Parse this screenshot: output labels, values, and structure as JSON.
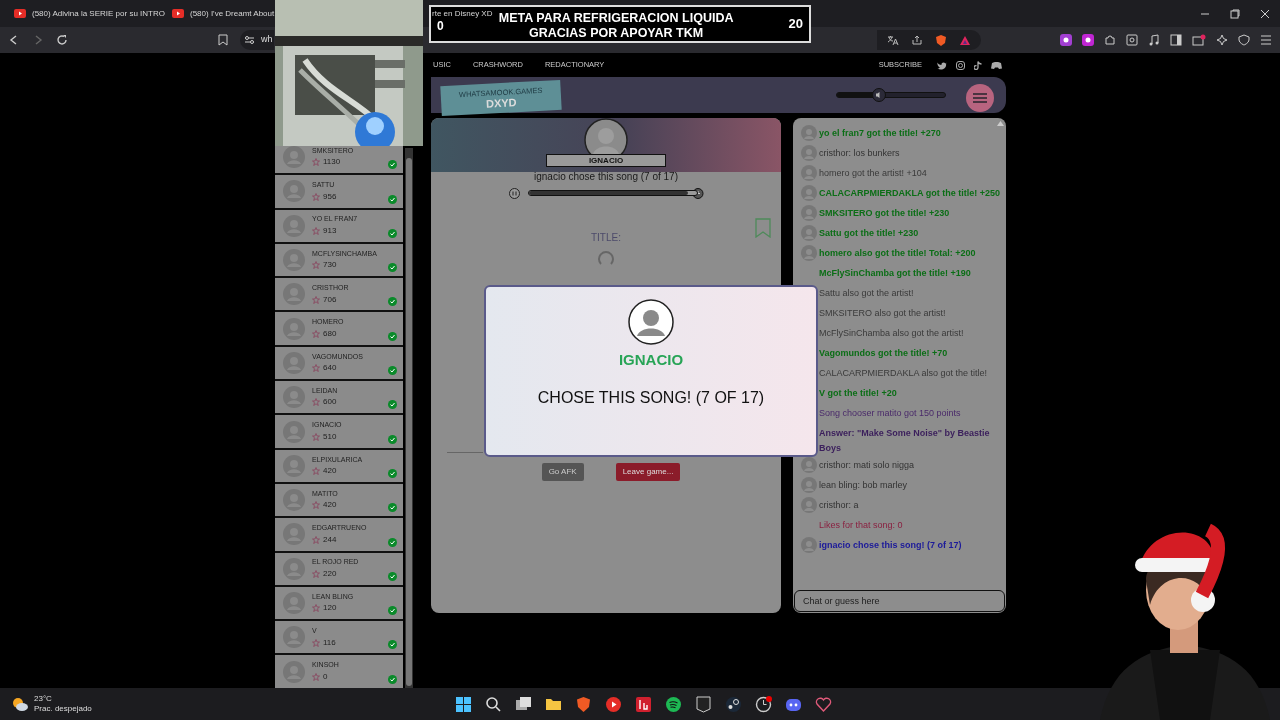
{
  "browser": {
    "tabs": [
      {
        "label": "(580) Adivina la SERIE por su INTRO",
        "selected": false
      },
      {
        "label": "(580) I've Dreamt About",
        "selected": false
      },
      {
        "label": "rte en Disney XD",
        "selected": false
      }
    ],
    "address": "wh"
  },
  "donation_goal": {
    "current": "0",
    "text": "META PARA REFRIGERACION LIQUIDA GRACIAS POR APOYAR TKM",
    "target": "20"
  },
  "site_nav": {
    "links": [
      "USIC",
      "CRASHWORD",
      "REDACTIONARY"
    ],
    "subscribe": "SUBSCRIBE"
  },
  "header": {
    "logo_top": "WHATSAMOOK.GAMES",
    "logo_bottom": "DXYD",
    "volume": {
      "level": 0.39
    }
  },
  "players": [
    {
      "name": "SMKSITERO",
      "score": "1130",
      "guessed": true
    },
    {
      "name": "SATTU",
      "score": "956",
      "guessed": true
    },
    {
      "name": "YO EL FRAN7",
      "score": "913",
      "guessed": true
    },
    {
      "name": "MCFLYSINCHAMBA",
      "score": "730",
      "guessed": true
    },
    {
      "name": "CRISTHOR",
      "score": "706",
      "guessed": true
    },
    {
      "name": "HOMERO",
      "score": "680",
      "guessed": true
    },
    {
      "name": "VAGOMUNDOS",
      "score": "640",
      "guessed": true
    },
    {
      "name": "LEIDAN",
      "score": "600",
      "guessed": true
    },
    {
      "name": "IGNACIO",
      "score": "510",
      "guessed": true
    },
    {
      "name": "ELPIXULARICA",
      "score": "420",
      "guessed": true
    },
    {
      "name": "MATITO",
      "score": "420",
      "guessed": true
    },
    {
      "name": "EDGARTRUENO",
      "score": "244",
      "guessed": true
    },
    {
      "name": "EL ROJO RED",
      "score": "220",
      "guessed": true
    },
    {
      "name": "LEAN BLING",
      "score": "120",
      "guessed": true
    },
    {
      "name": "V",
      "score": "116",
      "guessed": true
    },
    {
      "name": "KINSOH",
      "score": "0",
      "guessed": true
    }
  ],
  "song": {
    "chooser": "IGNACIO",
    "status": "ignacio chose this song (7 of 17)",
    "progress": {
      "level": 0.95
    },
    "title_label": "TITLE:"
  },
  "buttons": [
    {
      "label": "Go AFK",
      "kind": "neutral"
    },
    {
      "label": "Leave game...",
      "kind": "danger"
    }
  ],
  "modal": {
    "name": "IGNACIO",
    "message": "CHOSE THIS SONG! (7 OF 17)"
  },
  "chat": [
    {
      "kind": "title",
      "avatar": true,
      "text": "yo el fran7 got the title! +270"
    },
    {
      "kind": "user",
      "avatar": true,
      "text": "cristhor: los bunkers"
    },
    {
      "kind": "artist",
      "avatar": true,
      "text": "homero got the artist! +104"
    },
    {
      "kind": "title",
      "avatar": true,
      "text": "CALACARPMIERDAKLA got the title! +250"
    },
    {
      "kind": "title",
      "avatar": true,
      "text": "SMKSITERO got the title! +230"
    },
    {
      "kind": "title",
      "avatar": true,
      "text": "Sattu got the title! +230"
    },
    {
      "kind": "title",
      "avatar": true,
      "text": "homero also got the title! Total: +200"
    },
    {
      "kind": "title",
      "avatar": false,
      "text": "McFlySinChamba got the title! +190"
    },
    {
      "kind": "artist",
      "avatar": false,
      "text": "Sattu also got the artist!"
    },
    {
      "kind": "artist",
      "avatar": false,
      "text": "SMKSITERO also got the artist!"
    },
    {
      "kind": "artist",
      "avatar": false,
      "text": "McFlySinChamba also got the artist!"
    },
    {
      "kind": "title",
      "avatar": false,
      "text": "Vagomundos got the title! +70"
    },
    {
      "kind": "artist",
      "avatar": false,
      "text": "CALACARPMIERDAKLA also got the title!"
    },
    {
      "kind": "title",
      "avatar": false,
      "text": "V got the title! +20"
    },
    {
      "kind": "system",
      "avatar": false,
      "text": "Song chooser matito got 150 points"
    },
    {
      "kind": "answer",
      "avatar": false,
      "text": "Answer: \"Make Some Noise\" by Beastie Boys"
    },
    {
      "kind": "user",
      "avatar": true,
      "text": "cristhor: mati solo nigga"
    },
    {
      "kind": "user",
      "avatar": true,
      "text": "lean bling: bob marley"
    },
    {
      "kind": "user",
      "avatar": true,
      "text": "cristhor: a"
    },
    {
      "kind": "likes",
      "avatar": false,
      "text": "Likes for that song: 0"
    },
    {
      "kind": "chooser",
      "avatar": true,
      "text": "ignacio chose this song! (7 of 17)"
    }
  ],
  "chat_input": {
    "placeholder": "Chat or guess here"
  },
  "taskbar": {
    "weather": {
      "temp": "23°C",
      "condition": "Prac. despejado"
    }
  }
}
